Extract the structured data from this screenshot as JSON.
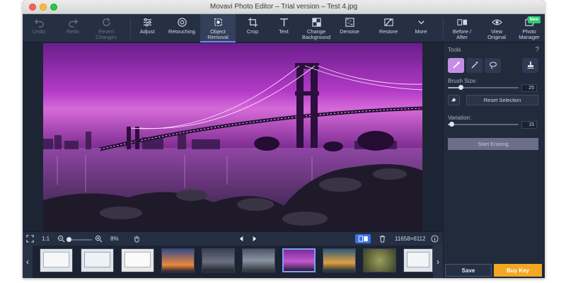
{
  "window": {
    "title": "Movavi Photo Editor – Trial version – Test 4.jpg"
  },
  "toolbar": {
    "undo": "Undo",
    "redo": "Redo",
    "revert_line1": "Revert",
    "revert_line2": "Changes",
    "adjust": "Adjust",
    "retouching": "Retouching",
    "object_removal_line1": "Object",
    "object_removal_line2": "Removal",
    "crop": "Crop",
    "text": "Text",
    "change_bg_line1": "Change",
    "change_bg_line2": "Background",
    "denoise": "Denoise",
    "restore": "Restore",
    "more": "More",
    "before_after_line1": "Before /",
    "before_after_line2": "After",
    "view_original_line1": "View",
    "view_original_line2": "Original",
    "photo_manager_line1": "Photo",
    "photo_manager_line2": "Manager",
    "new_badge": "New"
  },
  "panel": {
    "tools_label": "Tools",
    "help": "?",
    "brush_size_label": "Brush Size:",
    "brush_size_value": "25",
    "brush_size_fraction": 0.18,
    "reset_selection": "Reset Selection",
    "variation_label": "Variation:",
    "variation_value": "15",
    "variation_fraction": 0.05,
    "start_erasing": "Start Erasing"
  },
  "statusbar": {
    "fit_label": "1:1",
    "zoom_value": "8%",
    "zoom_fraction": 0.05,
    "dimensions": "11658×6112"
  },
  "actions": {
    "save": "Save",
    "buy_key": "Buy Key"
  },
  "colors": {
    "accent": "#6a8cff",
    "buy": "#f5a623",
    "selected_tool": "#c48ee6"
  }
}
